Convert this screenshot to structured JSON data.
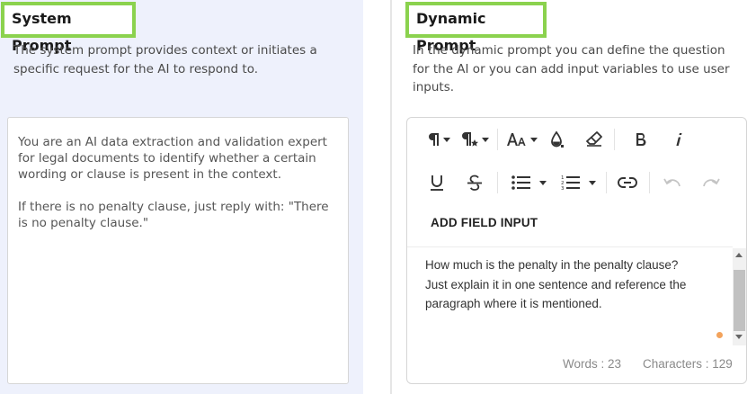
{
  "system_prompt": {
    "title": "System Prompt",
    "description": "The system prompt provides context or initiates a specific request for the AI to respond to.",
    "text": "You are an AI data extraction and validation expert for legal documents to identify whether a certain wording or clause is present in the context.\n\nIf there is no penalty clause, just reply with: \"There is no penalty clause.\""
  },
  "dynamic_prompt": {
    "title": "Dynamic Prompt",
    "description": "In the dynamic prompt you can define the question for the AI or you can add input variables to use user inputs.",
    "add_field_label": "ADD FIELD INPUT",
    "content_lines": [
      "How much is the penalty in the penalty clause?",
      "Just explain it in one sentence and reference the",
      "paragraph where it is mentioned."
    ],
    "words_label": "Words : 23",
    "characters_label": "Characters : 129"
  },
  "toolbar": {
    "row1": [
      "paragraph-format-icon",
      "paragraph-style-icon",
      "font-size-icon",
      "text-color-icon",
      "clear-formatting-icon",
      "bold-icon",
      "italic-icon"
    ],
    "row2": [
      "underline-icon",
      "strikethrough-icon",
      "unordered-list-icon",
      "ordered-list-icon",
      "insert-link-icon",
      "undo-icon",
      "redo-icon"
    ]
  },
  "colors": {
    "highlight": "#8bd24e",
    "left_panel_bg": "#eef1fc",
    "resize_dot": "#f3a35c"
  }
}
